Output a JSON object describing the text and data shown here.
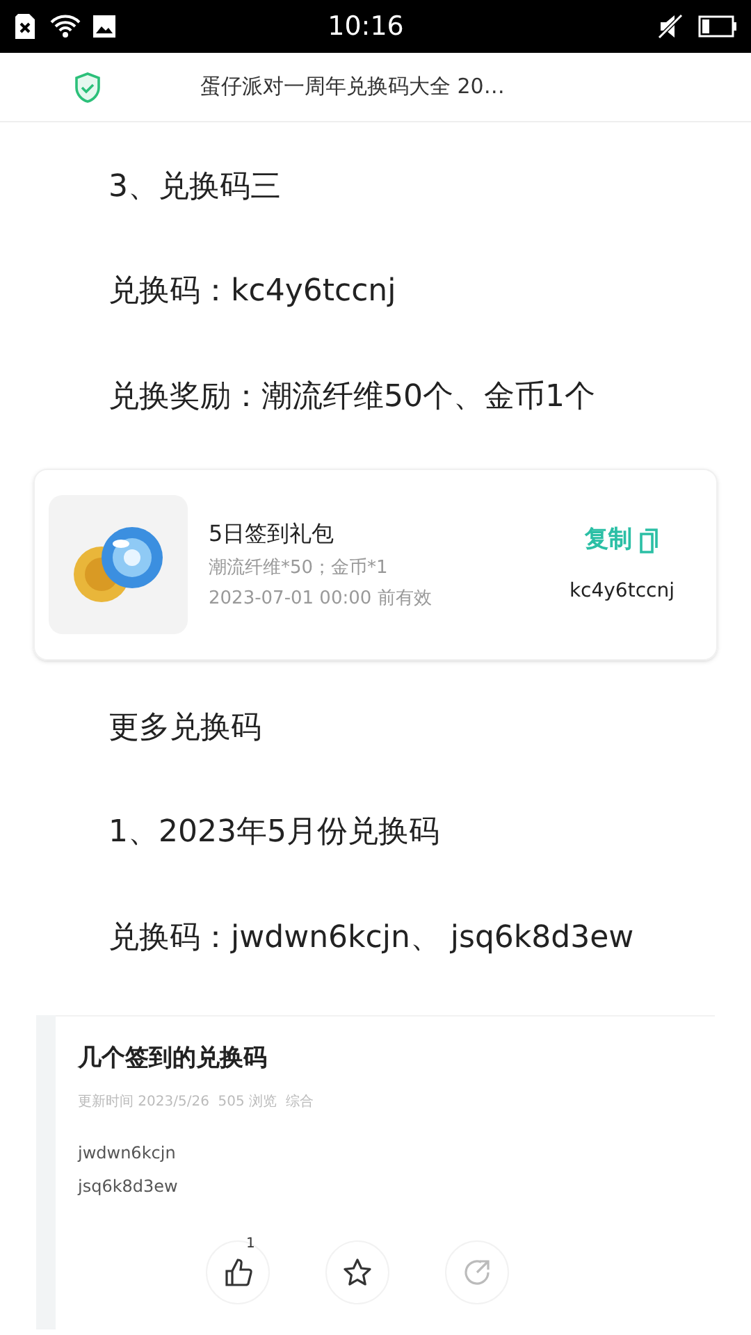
{
  "status_bar": {
    "time": "10:16"
  },
  "header": {
    "title": "蛋仔派对一周年兑换码大全 20…"
  },
  "paragraphs_top": [
    "3、兑换码三",
    "兑换码：kc4y6tccnj",
    "兑换奖励：潮流纤维50个、金币1个"
  ],
  "gift_card": {
    "title": "5日签到礼包",
    "rewards": "潮流纤维*50；金币*1",
    "expiry": "2023-07-01 00:00 前有效",
    "copy_label": "复制",
    "code": "kc4y6tccnj"
  },
  "paragraphs_bottom": [
    "更多兑换码",
    "1、2023年5月份兑换码",
    "兑换码：jwdwn6kcjn、 jsq6k8d3ew"
  ],
  "post_card": {
    "title": "几个签到的兑换码",
    "meta": "更新时间 2023/5/26  505 浏览  综合",
    "codes": [
      "jwdwn6kcjn",
      "jsq6k8d3ew"
    ],
    "actions": [
      {
        "kind": "like",
        "count": "1"
      },
      {
        "kind": "favorite"
      },
      {
        "kind": "share"
      }
    ]
  }
}
